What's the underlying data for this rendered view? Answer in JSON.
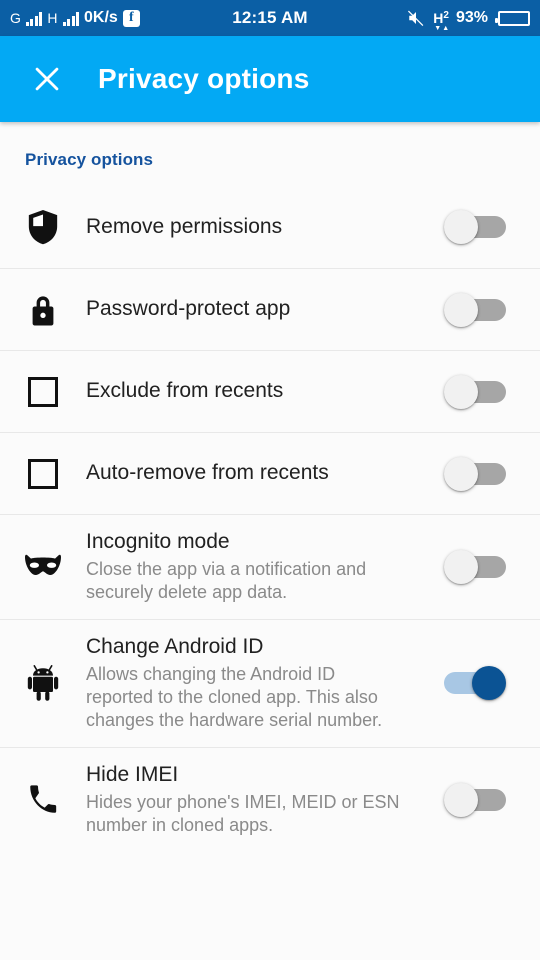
{
  "status_bar": {
    "network_type_1": "G",
    "network_type_2": "H",
    "data_speed": "0K/s",
    "app_icon": "f",
    "time": "12:15 AM",
    "mute_icon": "speaker-mute-icon",
    "network_indicator": "H",
    "network_sub": "2",
    "battery_percent": "93%"
  },
  "app_bar": {
    "close_icon": "close-icon",
    "title": "Privacy options"
  },
  "section": {
    "header": "Privacy options"
  },
  "colors": {
    "status_bar_bg": "#0b5fa5",
    "app_bar_bg": "#03a9f4",
    "section_header": "#15539e",
    "switch_on_thumb": "#0b5394",
    "switch_on_track": "#a8c7e4",
    "switch_off_thumb": "#f1f1f1",
    "switch_off_track": "#a6a6a6",
    "page_bg": "#fbfbfb",
    "title_text": "#212121",
    "sub_text": "#8a8a8a"
  },
  "rows": [
    {
      "icon": "shield-icon",
      "title": "Remove permissions",
      "subtitle": "",
      "toggle_state": "off",
      "toggle_label": "Remove permissions toggle"
    },
    {
      "icon": "lock-icon",
      "title": "Password-protect app",
      "subtitle": "",
      "toggle_state": "off",
      "toggle_label": "Password-protect app toggle"
    },
    {
      "icon": "square-outline-icon",
      "title": "Exclude from recents",
      "subtitle": "",
      "toggle_state": "off",
      "toggle_label": "Exclude from recents toggle"
    },
    {
      "icon": "square-outline-icon",
      "title": "Auto-remove from recents",
      "subtitle": "",
      "toggle_state": "off",
      "toggle_label": "Auto-remove from recents toggle"
    },
    {
      "icon": "mask-icon",
      "title": "Incognito mode",
      "subtitle": "Close the app via a notification and securely delete app data.",
      "toggle_state": "off",
      "toggle_label": "Incognito mode toggle"
    },
    {
      "icon": "android-icon",
      "title": "Change Android ID",
      "subtitle": "Allows changing the Android ID reported to the cloned app. This also changes the hardware serial number.",
      "toggle_state": "on",
      "toggle_label": "Change Android ID toggle"
    },
    {
      "icon": "phone-icon",
      "title": "Hide IMEI",
      "subtitle": "Hides your phone's IMEI, MEID or ESN number in cloned apps.",
      "toggle_state": "off",
      "toggle_label": "Hide IMEI toggle"
    }
  ]
}
